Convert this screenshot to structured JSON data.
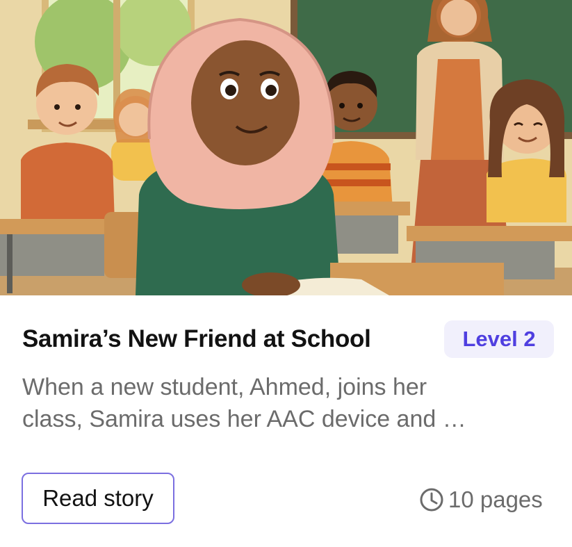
{
  "story": {
    "title": "Samira’s New Friend at School",
    "level": "Level 2",
    "description_lines": [
      "When a new student, Ahmed, joins her",
      "class, Samira uses her AAC device and …"
    ],
    "read_label": "Read story",
    "pages_label": "10 pages"
  },
  "icons": {
    "pages": "clock-icon"
  },
  "colors": {
    "accent": "#4f3fe0",
    "badge_bg": "#f1f0fc",
    "button_border": "#7b6fe0",
    "muted_text": "#6b6b6b",
    "chalkboard": "#3f6b48",
    "hijab": "#f0b5a4",
    "sweater": "#2f6b4f"
  }
}
